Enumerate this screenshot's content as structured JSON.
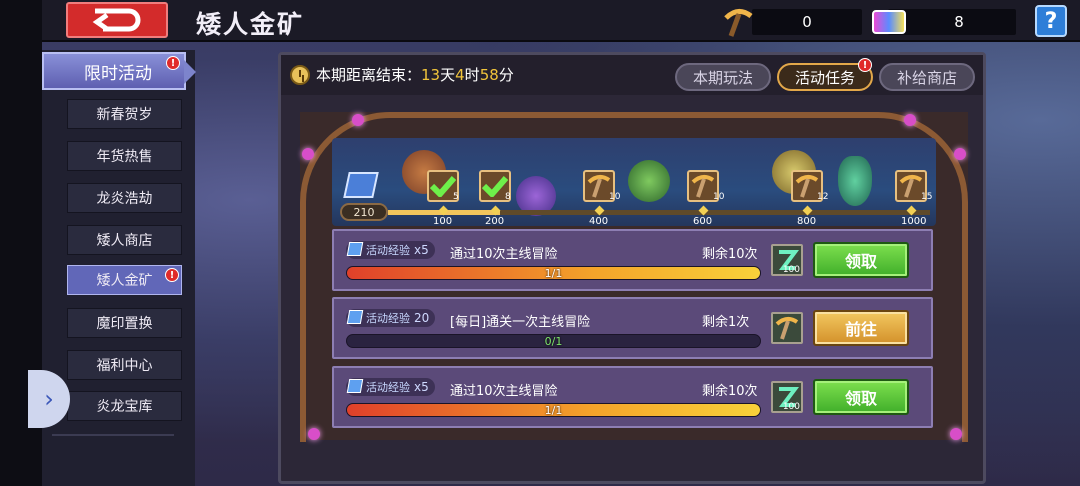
{
  "header": {
    "title": "矮人金矿",
    "pickaxe_count": "0",
    "gem_count": "8",
    "help_label": "?"
  },
  "sidebar": {
    "heading": "限时活动",
    "items": [
      {
        "label": "新春贺岁"
      },
      {
        "label": "年货热售"
      },
      {
        "label": "龙炎浩劫"
      },
      {
        "label": "矮人商店"
      },
      {
        "label": "矮人金矿"
      },
      {
        "label": "魔印置换"
      },
      {
        "label": "福利中心"
      },
      {
        "label": "炎龙宝库"
      }
    ]
  },
  "panel": {
    "timer_prefix": "本期距离结束：",
    "days": "13",
    "day_unit": "天",
    "hours": "4",
    "hour_unit": "时",
    "minutes": "58",
    "minute_unit": "分",
    "tabs": [
      {
        "label": "本期玩法"
      },
      {
        "label": "活动任务"
      },
      {
        "label": "补给商店"
      }
    ]
  },
  "progress": {
    "total": "210",
    "milestones": [
      {
        "label": "100",
        "count": "5",
        "claimed": true
      },
      {
        "label": "200",
        "count": "8",
        "claimed": true
      },
      {
        "label": "400",
        "count": "10",
        "claimed": false
      },
      {
        "label": "600",
        "count": "10",
        "claimed": false
      },
      {
        "label": "800",
        "count": "12",
        "claimed": false
      },
      {
        "label": "1000",
        "count": "15",
        "claimed": false
      }
    ]
  },
  "tasks": [
    {
      "exp_label": "活动经验",
      "exp_amount": "x5",
      "name": "通过10次主线冒险",
      "remaining": "剩余10次",
      "progress": "1/1",
      "fraction": 1,
      "reward_count": "100",
      "reward_type": "exp-scroll",
      "button": "领取",
      "button_style": "green"
    },
    {
      "exp_label": "活动经验",
      "exp_amount": "20",
      "name": "[每日]通关一次主线冒险",
      "remaining": "剩余1次",
      "progress": "0/1",
      "fraction": 0,
      "reward_count": "",
      "reward_type": "pickaxe",
      "button": "前往",
      "button_style": "gold"
    },
    {
      "exp_label": "活动经验",
      "exp_amount": "x5",
      "name": "通过10次主线冒险",
      "remaining": "剩余10次",
      "progress": "1/1",
      "fraction": 1,
      "reward_count": "100",
      "reward_type": "exp-scroll",
      "button": "领取",
      "button_style": "green"
    }
  ],
  "colors": {
    "accent_gold": "#f1c43b",
    "button_green": "#5ec83a",
    "button_gold": "#e8ae45",
    "badge_red": "#e02a2a"
  }
}
